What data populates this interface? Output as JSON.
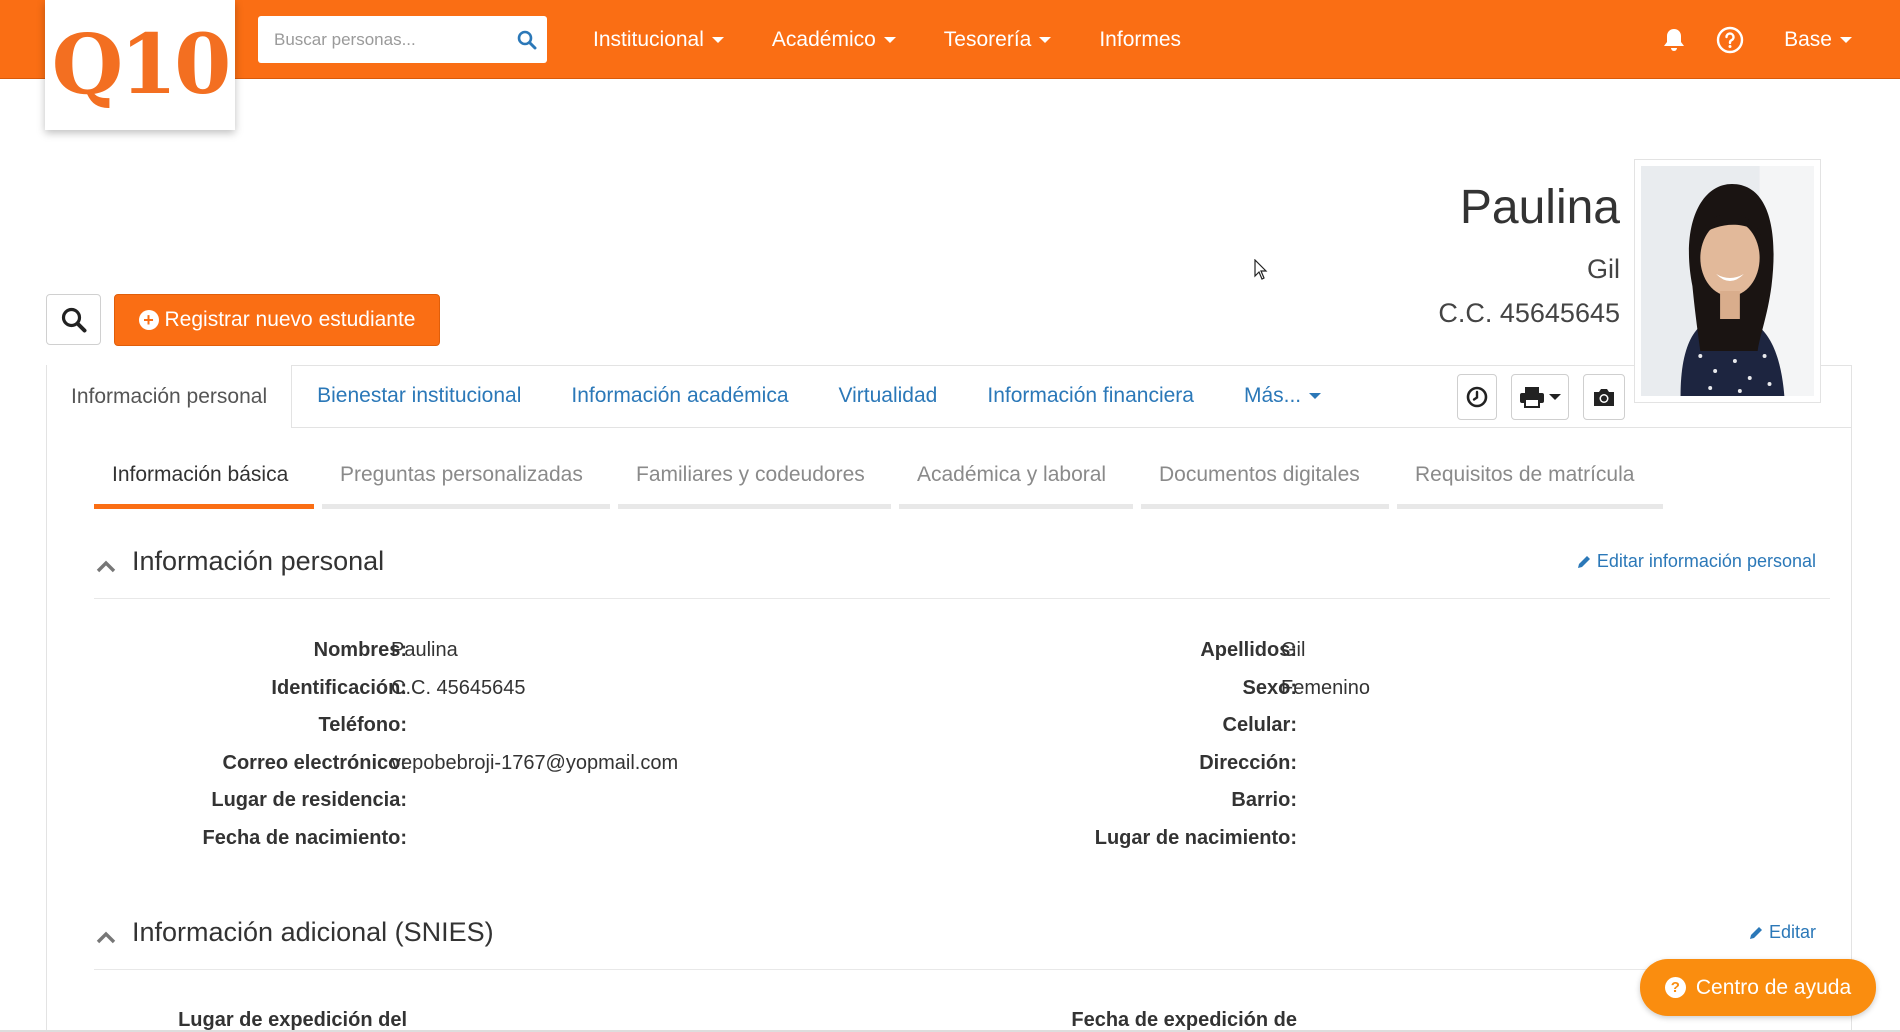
{
  "app": {
    "logo_text": "Q10",
    "brand_color": "#fa6e14"
  },
  "search": {
    "placeholder": "Buscar personas..."
  },
  "nav": {
    "items": [
      {
        "label": "Institucional",
        "dropdown": true
      },
      {
        "label": "Académico",
        "dropdown": true
      },
      {
        "label": "Tesorería",
        "dropdown": true
      },
      {
        "label": "Informes",
        "dropdown": false
      }
    ],
    "user_label": "Base",
    "icons": [
      "bell-icon",
      "help-circle-icon"
    ]
  },
  "profile": {
    "first_name": "Paulina",
    "last_name": "Gil",
    "id_display": "C.C. 45645645"
  },
  "actions": {
    "register_label": "Registrar nuevo estudiante"
  },
  "main_tabs": [
    {
      "label": "Información personal",
      "active": true
    },
    {
      "label": "Bienestar institucional",
      "active": false
    },
    {
      "label": "Información académica",
      "active": false
    },
    {
      "label": "Virtualidad",
      "active": false
    },
    {
      "label": "Información financiera",
      "active": false
    },
    {
      "label": "Más...",
      "active": false
    }
  ],
  "sub_tabs": [
    {
      "label": "Información básica",
      "active": true
    },
    {
      "label": "Preguntas personalizadas",
      "active": false
    },
    {
      "label": "Familiares y codeudores",
      "active": false
    },
    {
      "label": "Académica y laboral",
      "active": false
    },
    {
      "label": "Documentos digitales",
      "active": false
    },
    {
      "label": "Requisitos de matrícula",
      "active": false
    }
  ],
  "personal_section": {
    "title": "Información personal",
    "edit_label": "Editar información personal",
    "left_fields": [
      {
        "label": "Nombres:",
        "value": "Paulina"
      },
      {
        "label": "Identificación:",
        "value": "C.C. 45645645"
      },
      {
        "label": "Teléfono:",
        "value": ""
      },
      {
        "label": "Correo electrónico:",
        "value": "vepobebroji-1767@yopmail.com"
      },
      {
        "label": "Lugar de residencia:",
        "value": ""
      },
      {
        "label": "Fecha de nacimiento:",
        "value": ""
      }
    ],
    "right_fields": [
      {
        "label": "Apellidos:",
        "value": "Gil"
      },
      {
        "label": "Sexo:",
        "value": "Femenino"
      },
      {
        "label": "Celular:",
        "value": ""
      },
      {
        "label": "Dirección:",
        "value": ""
      },
      {
        "label": "Barrio:",
        "value": ""
      },
      {
        "label": "Lugar de nacimiento:",
        "value": ""
      }
    ]
  },
  "snies_section": {
    "title": "Información adicional (SNIES)",
    "edit_label": "Editar",
    "partial_labels": [
      "Lugar de expedición del",
      "Fecha de expedición de"
    ]
  },
  "help": {
    "label": "Centro de ayuda",
    "color": "#fa8d0f"
  },
  "colors": {
    "link": "#2b78b8",
    "nav_bg": "#fa6e14"
  }
}
